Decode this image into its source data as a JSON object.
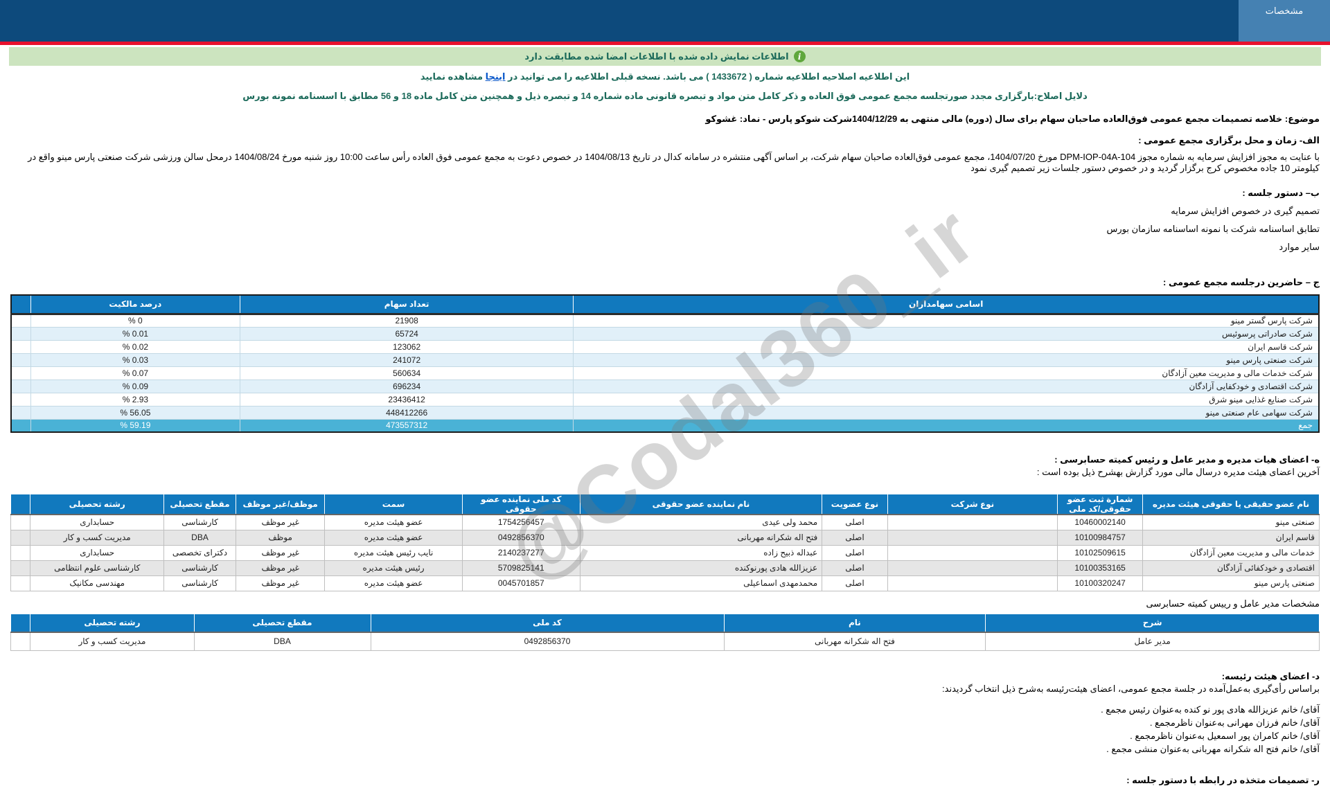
{
  "header": {
    "tab_label": "مشخصات"
  },
  "notices": {
    "info_icon_glyph": "i",
    "signed_match": "اطلاعات نمایش داده شده با اطلاعات امضا شده مطابقت دارد",
    "amendment_pre": "این اطلاعیه اصلاحیه اطلاعیه شماره ( 1433672 ) می باشد. نسخه قبلی اطلاعیه را می توانید در ",
    "amendment_link": "اینجا",
    "amendment_post": " مشاهده نمایید",
    "reasons": "دلایل اصلاح:بارگزاری مجدد صورتجلسه مجمع عمومی فوق العاده و ذکر کامل متن مواد و تبصره قانونی ماده شماره 14 و تبصره ذیل و همچنین متن کامل ماده 18 و 56 مطابق با اسسنامه نمونه بورس"
  },
  "subject": "موضوع: خلاصه تصمیمات مجمع عمومی فوق‌العاده صاحبان سهام برای سال (دوره) مالی منتهی به 1404/12/29شرکت شوکو پارس - نماد: غشوکو",
  "section_a": {
    "title": "الف- زمان و محل برگزاری مجمع عمومی :",
    "body": "با عنایت به مجوز افزایش سرمایه به شماره مجوز DPM-IOP-04A-104 مورخ 1404/07/20، مجمع عمومی فوق‌العاده صاحبان سهام شرکت، بر اساس آگهی منتشره در سامانه کدال در تاریخ 1404/08/13 در خصوص دعوت به مجمع عمومی فوق العاده رأس ساعت 10:00 روز شنبه مورخ 1404/08/24 درمحل سالن ورزشی شرکت صنعتی پارس مینو واقع در کیلومتر 10 جاده مخصوص کرج  برگزار گردید و در خصوص دستور جلسات زیر تصمیم گیری نمود"
  },
  "section_b": {
    "title": "ب– دستور جلسه :",
    "items": [
      "تصمیم گیری در خصوص افزایش سرمایه",
      "تطابق اساسنامه شرکت با نمونه اساسنامه سازمان بورس",
      "سایر موارد"
    ]
  },
  "presence": {
    "title": "ج – حاضرین درجلسه مجمع عمومی :",
    "headers": [
      "اسامی سهامداران",
      "تعداد سهام",
      "درصد مالکیت"
    ],
    "rows": [
      {
        "name": "شرکت پارس گستر مینو",
        "shares": "21908",
        "percent": "% 0"
      },
      {
        "name": "شرکت صادراتی پرسوئیس",
        "shares": "65724",
        "percent": "% 0.01"
      },
      {
        "name": "شرکت قاسم ایران",
        "shares": "123062",
        "percent": "% 0.02"
      },
      {
        "name": "شرکت صنعتی پارس مینو",
        "shares": "241072",
        "percent": "% 0.03"
      },
      {
        "name": "شرکت خدمات مالی و مدیریت معین آزادگان",
        "shares": "560634",
        "percent": "% 0.07"
      },
      {
        "name": "شرکت اقتصادی و خودکفایی آزادگان",
        "shares": "696234",
        "percent": "% 0.09"
      },
      {
        "name": "شرکت صنایع غذایی مینو شرق",
        "shares": "23436412",
        "percent": "% 2.93"
      },
      {
        "name": "شرکت سهامی عام صنعتی مینو",
        "shares": "448412266",
        "percent": "% 56.05"
      }
    ],
    "total": {
      "label": "جمع",
      "shares": "473557312",
      "percent": "% 59.19"
    }
  },
  "board": {
    "title": "ه- اعضای هیات مدیره و مدیر عامل و رئیس کمیته حسابرسی :",
    "subtitle": "آخرین اعضای هیئت مدیره درسال مالی مورد گزارش بهشرح ذیل بوده است :",
    "headers": [
      "نام عضو حقیقی یا حقوقی هیئت مدیره",
      "شمارة ثبت عضو حقوقی/کد ملی",
      "نوع شرکت",
      "نوع عضویت",
      "نام نماینده عضو حقوقی",
      "کد ملی نماینده عضو حقوقی",
      "سمت",
      "موظف/غیر موظف",
      "مقطع تحصیلی",
      "رشته تحصیلی"
    ],
    "rows": [
      {
        "name": "صنعتی مینو",
        "reg": "10460002140",
        "company_type": "",
        "membership": "اصلی",
        "rep": "محمد ولی عیدی",
        "rep_code": "1754256457",
        "position": "عضو هیئت مدیره",
        "duty": "غیر موظف",
        "degree": "کارشناسی",
        "field": "حسابداری"
      },
      {
        "name": "قاسم ایران",
        "reg": "10100984757",
        "company_type": "",
        "membership": "اصلی",
        "rep": "فتح اله شکرانه مهربانی",
        "rep_code": "0492856370",
        "position": "عضو هیئت مدیره",
        "duty": "موظف",
        "degree": "DBA",
        "field": "مدیریت کسب و کار"
      },
      {
        "name": "خدمات مالی و مدیریت معین آزادگان",
        "reg": "10102509615",
        "company_type": "",
        "membership": "اصلی",
        "rep": "عبداله ذبیح زاده",
        "rep_code": "2140237277",
        "position": "نایب رئیس هیئت مدیره",
        "duty": "غیر موظف",
        "degree": "دکترای تخصصی",
        "field": "حسابداری"
      },
      {
        "name": "اقتصادی و خودکفائی آزادگان",
        "reg": "10100353165",
        "company_type": "",
        "membership": "اصلی",
        "rep": "عزیزالله هادی پورنوکنده",
        "rep_code": "5709825141",
        "position": "رئیس هیئت مدیره",
        "duty": "غیر موظف",
        "degree": "کارشناسی",
        "field": "کارشناسی علوم انتظامی"
      },
      {
        "name": "صنعتی پارس مینو",
        "reg": "10100320247",
        "company_type": "",
        "membership": "اصلی",
        "rep": "محمدمهدی اسماعیلی",
        "rep_code": "0045701857",
        "position": "عضو هیئت مدیره",
        "duty": "غیر موظف",
        "degree": "کارشناسی",
        "field": "مهندسی مکانیک"
      }
    ]
  },
  "ceo": {
    "label": "مشخصات مدیر عامل و رییس کمیته حسابرسی",
    "headers": [
      "شرح",
      "نام",
      "کد ملی",
      "مقطع تحصیلی",
      "رشته تحصیلی"
    ],
    "row": {
      "desc": "مدیر عامل",
      "name": "فتح اله شکرانه مهربانی",
      "code": "0492856370",
      "degree": "DBA",
      "field": "مدیریت کسب و کار"
    }
  },
  "chairs": {
    "title": "د- اعضای هیئت رئیسه:",
    "intro": "براساس رأی‌گیری به‌عمل‌آمده در جلسة مجمع عمومی، اعضای هیئت‌رئیسه به‌شرح ذیل انتخاب گردیدند:",
    "members": [
      "آقای/ خانم  عزیزالله هادی پور نو کنده  به‌عنوان رئیس مجمع .",
      "آقای/ خانم  فرزان مهرانی  به‌عنوان ناظرمجمع .",
      "آقای/ خانم  کامران پور اسمعیل  به‌عنوان ناظرمجمع .",
      "آقای/ خانم  فتح اله شکرانه مهربانی  به‌عنوان منشی مجمع ."
    ]
  },
  "resolutions": {
    "title": "ر- تصمیمات متخذه در رابطه با دستور جلسه :"
  },
  "watermark": {
    "text": "@Codal360_ir"
  },
  "colors": {
    "header_bar": "#0d4a7c",
    "tab_bg": "#4581b2",
    "red_line": "#e8112d",
    "green_bar_bg": "#cce4bf",
    "notice_text": "#1b6a5a",
    "table_header_bg": "#1179be",
    "row_alt_blue": "#e1f0f9",
    "row_alt_gray": "#e6e6e6",
    "total_row_bg": "#4ab2d6",
    "link": "#0a58ca"
  }
}
